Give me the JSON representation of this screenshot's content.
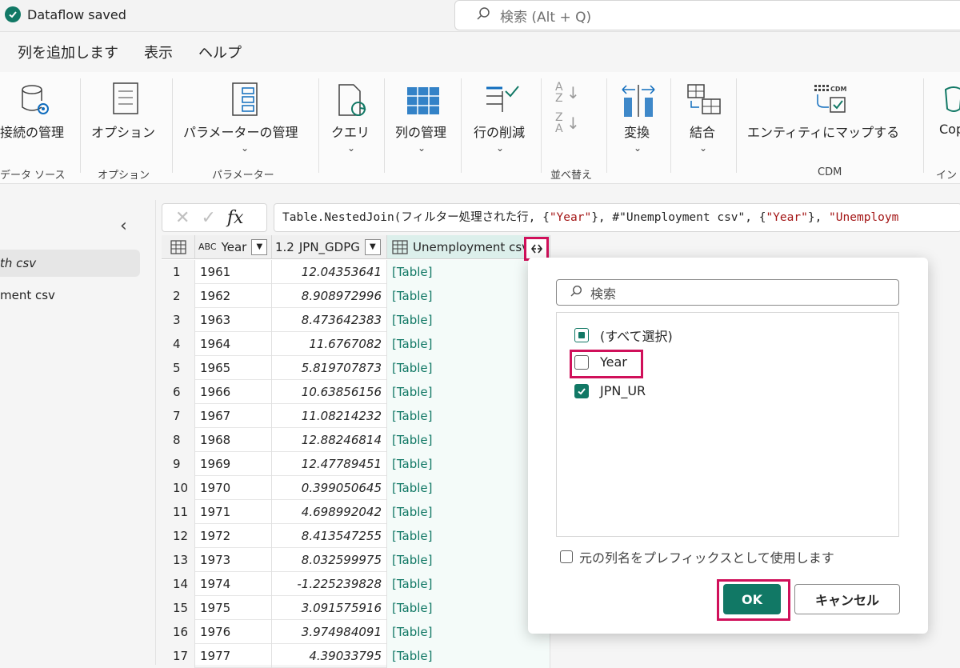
{
  "status": {
    "text": "Dataflow saved"
  },
  "search": {
    "placeholder": "検索 (Alt + Q)"
  },
  "menu": [
    "列を追加します",
    "表示",
    "ヘルプ"
  ],
  "ribbon": {
    "manage_connections": "接続の管理",
    "options": "オプション",
    "manage_params": "パラメーターの管理",
    "query": "クエリ",
    "manage_columns": "列の管理",
    "reduce_rows": "行の削減",
    "transform": "変換",
    "combine": "結合",
    "map_entity": "エンティティにマップする",
    "copilot": "Cop",
    "groups": {
      "data_source": "データ ソース",
      "options": "オプション",
      "parameters": "パラメーター",
      "sort": "並べ替え",
      "cdm": "CDM",
      "insights": "イン"
    },
    "cdm_tag": "CDM"
  },
  "queries": [
    "th csv",
    "ment csv"
  ],
  "formula": {
    "prefix": "Table.NestedJoin(フィルター処理された行, {",
    "s1": "\"Year\"",
    "mid1": "}, #\"Unemployment csv\", {",
    "s2": "\"Year\"",
    "mid2": "}, ",
    "s3": "\"Unemploym"
  },
  "columns": {
    "year": {
      "type": "ABC",
      "name": "Year"
    },
    "gdp": {
      "type": "1.2",
      "name": "JPN_GDPG"
    },
    "unemp": {
      "name": "Unemployment csv"
    }
  },
  "rows": [
    {
      "idx": "1",
      "year": "1961",
      "gdp": "12.04353641",
      "tbl": "[Table]"
    },
    {
      "idx": "2",
      "year": "1962",
      "gdp": "8.908972996",
      "tbl": "[Table]"
    },
    {
      "idx": "3",
      "year": "1963",
      "gdp": "8.473642383",
      "tbl": "[Table]"
    },
    {
      "idx": "4",
      "year": "1964",
      "gdp": "11.6767082",
      "tbl": "[Table]"
    },
    {
      "idx": "5",
      "year": "1965",
      "gdp": "5.819707873",
      "tbl": "[Table]"
    },
    {
      "idx": "6",
      "year": "1966",
      "gdp": "10.63856156",
      "tbl": "[Table]"
    },
    {
      "idx": "7",
      "year": "1967",
      "gdp": "11.08214232",
      "tbl": "[Table]"
    },
    {
      "idx": "8",
      "year": "1968",
      "gdp": "12.88246814",
      "tbl": "[Table]"
    },
    {
      "idx": "9",
      "year": "1969",
      "gdp": "12.47789451",
      "tbl": "[Table]"
    },
    {
      "idx": "10",
      "year": "1970",
      "gdp": "0.399050645",
      "tbl": "[Table]"
    },
    {
      "idx": "11",
      "year": "1971",
      "gdp": "4.698992042",
      "tbl": "[Table]"
    },
    {
      "idx": "12",
      "year": "1972",
      "gdp": "8.413547255",
      "tbl": "[Table]"
    },
    {
      "idx": "13",
      "year": "1973",
      "gdp": "8.032599975",
      "tbl": "[Table]"
    },
    {
      "idx": "14",
      "year": "1974",
      "gdp": "-1.225239828",
      "tbl": "[Table]"
    },
    {
      "idx": "15",
      "year": "1975",
      "gdp": "3.091575916",
      "tbl": "[Table]"
    },
    {
      "idx": "16",
      "year": "1976",
      "gdp": "3.974984091",
      "tbl": "[Table]"
    },
    {
      "idx": "17",
      "year": "1977",
      "gdp": "4.39033795",
      "tbl": "[Table]"
    }
  ],
  "popup": {
    "search_placeholder": "検索",
    "items": [
      {
        "label": "(すべて選択)",
        "state": "partial"
      },
      {
        "label": "Year",
        "state": "unchecked"
      },
      {
        "label": "JPN_UR",
        "state": "checked"
      }
    ],
    "prefix_label": "元の列名をプレフィックスとして使用します",
    "ok": "OK",
    "cancel": "キャンセル"
  },
  "colors": {
    "accent": "#117865",
    "highlight": "#d0105a"
  }
}
